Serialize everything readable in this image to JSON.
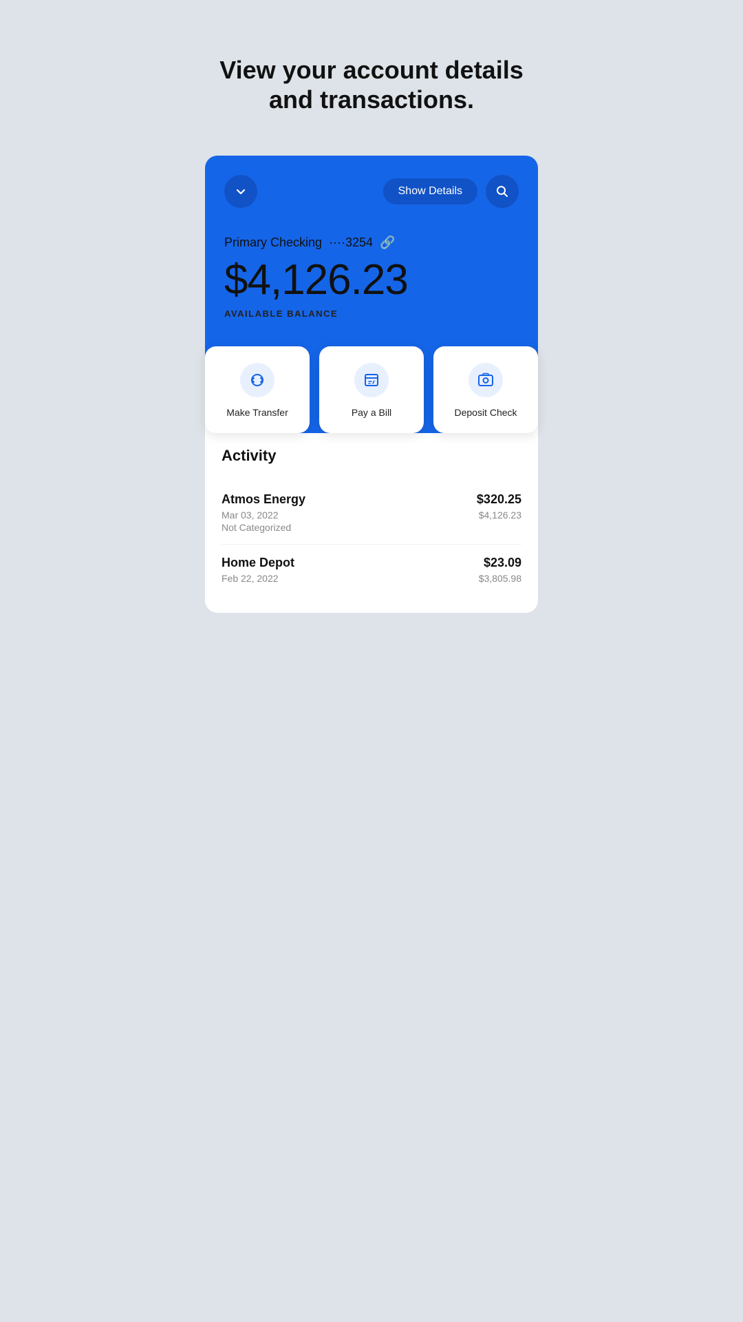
{
  "header": {
    "title": "View your account details and transactions."
  },
  "card": {
    "account_name": "Primary Checking",
    "account_number": "····3254",
    "balance": "$4,126.23",
    "balance_label": "AVAILABLE BALANCE",
    "show_details_label": "Show Details"
  },
  "actions": [
    {
      "id": "make-transfer",
      "label": "Make Transfer",
      "icon": "transfer"
    },
    {
      "id": "pay-bill",
      "label": "Pay a Bill",
      "icon": "bill"
    },
    {
      "id": "deposit-check",
      "label": "Deposit Check",
      "icon": "camera"
    }
  ],
  "activity": {
    "title": "Activity",
    "transactions": [
      {
        "name": "Atmos Energy",
        "date": "Mar 03, 2022",
        "category": "Not Categorized",
        "amount": "$320.25",
        "balance": "$4,126.23"
      },
      {
        "name": "Home Depot",
        "date": "Feb 22, 2022",
        "category": "",
        "amount": "$23.09",
        "balance": "$3,805.98"
      }
    ]
  }
}
